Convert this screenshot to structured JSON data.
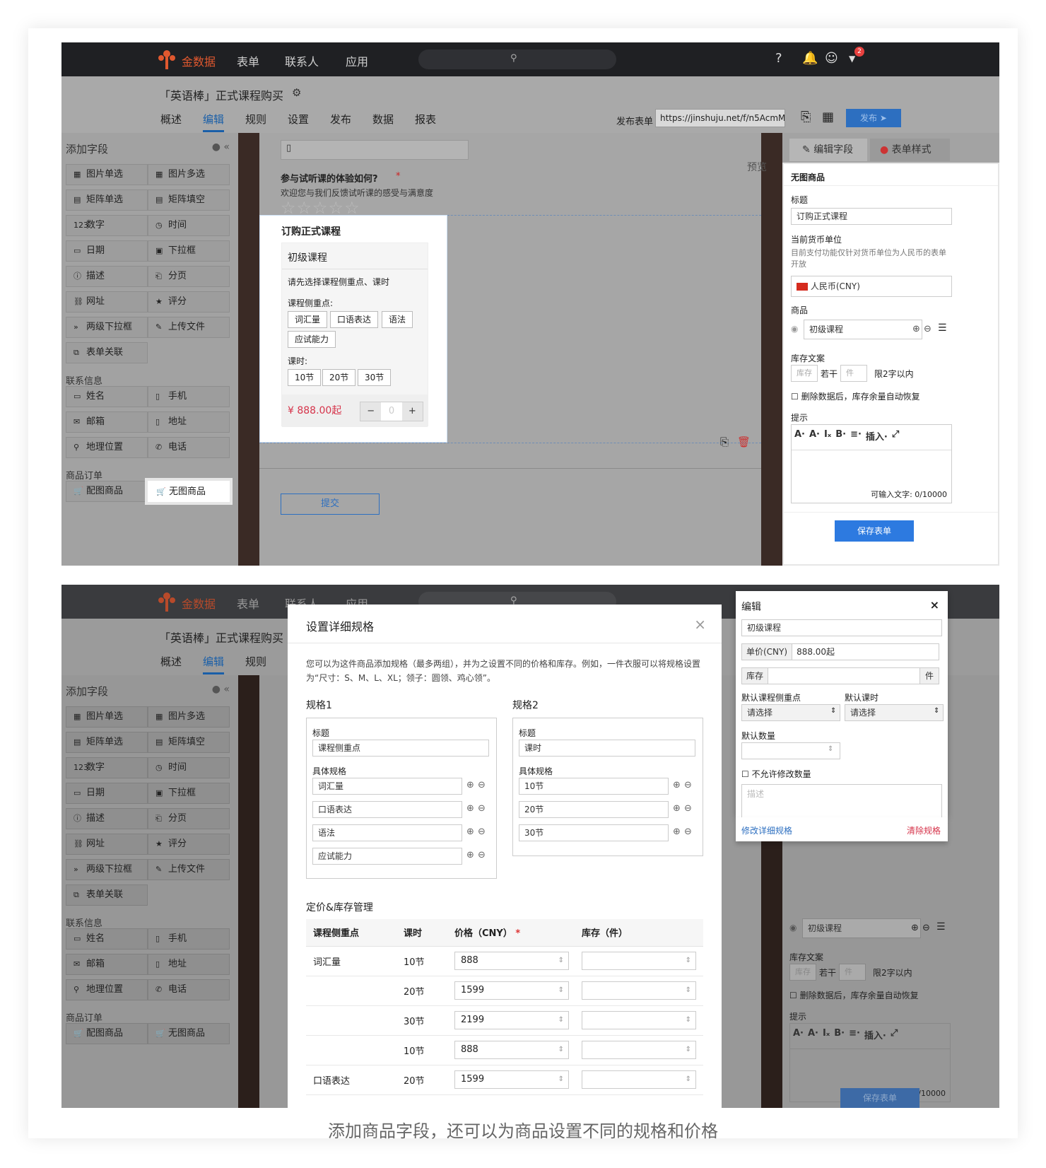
{
  "app": {
    "brand": "金数据",
    "nav": [
      "表单",
      "联系人",
      "应用"
    ],
    "notif_count": "2",
    "form_title": "「英语棒」正式课程购买",
    "tabs": [
      "概述",
      "编辑",
      "规则",
      "设置",
      "发布",
      "数据",
      "报表"
    ],
    "active_tab": "编辑",
    "publish_label": "发布表单",
    "publish_url": "https://jinshuju.net/f/n5AcmM",
    "publish_btn": "发布",
    "add_field_title": "添加字段",
    "collapse": "«",
    "icons": [
      "logo-icon",
      "search-icon",
      "help-icon",
      "bell-icon",
      "avatar-icon",
      "caret-down-icon",
      "copy-icon",
      "qrcode-icon",
      "send-icon",
      "gear-icon"
    ]
  },
  "fields": [
    [
      "图片单选",
      "图片多选"
    ],
    [
      "矩阵单选",
      "矩阵填空"
    ],
    [
      "数字",
      "时间"
    ],
    [
      "日期",
      "下拉框"
    ],
    [
      "描述",
      "分页"
    ],
    [
      "网址",
      "评分"
    ],
    [
      "两级下拉框",
      "上传文件"
    ],
    [
      "表单关联"
    ]
  ],
  "field_icons": [
    [
      "▦",
      "▦"
    ],
    [
      "▤",
      "▤"
    ],
    [
      "123",
      "◷"
    ],
    [
      "▭",
      "▣"
    ],
    [
      "ⓘ",
      "⎗"
    ],
    [
      "⛓",
      "★"
    ],
    [
      "»",
      "✎"
    ],
    [
      "⧉"
    ]
  ],
  "contact_group": "联系信息",
  "contact_fields": [
    [
      "姓名",
      "手机"
    ],
    [
      "邮箱",
      "地址"
    ],
    [
      "地理位置",
      "电话"
    ]
  ],
  "contact_icons": [
    [
      "▭",
      "▯"
    ],
    [
      "✉",
      "▯"
    ],
    [
      "⚲",
      "✆"
    ]
  ],
  "order_group": "商品订单",
  "order_fields": [
    "配图商品",
    "无图商品"
  ],
  "canvas": {
    "q_title": "参与试听课的体验如何?",
    "q_required": "*",
    "q_desc": "欢迎您与我们反馈试听课的感受与满意度",
    "preview": "预览",
    "section_title": "订购正式课程",
    "product_name": "初级课程",
    "choose_hint": "请先选择课程侧重点、课时",
    "focus_label": "课程侧重点:",
    "focus_opts": [
      "词汇量",
      "口语表达",
      "语法",
      "应试能力"
    ],
    "hours_label": "课时:",
    "hours_opts": [
      "10节",
      "20节",
      "30节"
    ],
    "price": "¥ 888.00起",
    "qty_minus": "−",
    "qty_value": "0",
    "qty_plus": "+",
    "submit": "提交"
  },
  "right": {
    "tab1": "编辑字段",
    "tab2": "表单样式",
    "field_type": "无图商品",
    "title_label": "标题",
    "title_value": "订购正式课程",
    "currency_label": "当前货币单位",
    "currency_note": "目前支付功能仅针对货币单位为人民币的表单开放",
    "currency_value": "人民币(CNY)",
    "product_label": "商品",
    "product_value": "初级课程",
    "stock_label": "库存文案",
    "stock_ph1": "库存",
    "stock_mid": "若干",
    "stock_ph2": "件",
    "stock_limit": "限2字以内",
    "auto_restore": "删除数据后，库存余量自动恢复",
    "hint_label": "提示",
    "toolbar": [
      "A·",
      "A·",
      "Iₓ",
      "B·",
      "≡·",
      "插入·",
      "⤢"
    ],
    "char_count": "可输入文字: 0/10000",
    "save": "保存表单"
  },
  "modal": {
    "title": "设置详细规格",
    "close": "×",
    "desc": "您可以为这件商品添加规格（最多两组），并为之设置不同的价格和库存。例如，一件衣服可以将规格设置为“尺寸：S、M、L、XL；领子：圆领、鸡心领”。",
    "spec1": {
      "heading": "规格1",
      "title_label": "标题",
      "title_value": "课程侧重点",
      "items_label": "具体规格",
      "items": [
        "词汇量",
        "口语表达",
        "语法",
        "应试能力"
      ]
    },
    "spec2": {
      "heading": "规格2",
      "title_label": "标题",
      "title_value": "课时",
      "items_label": "具体规格",
      "items": [
        "10节",
        "20节",
        "30节"
      ]
    },
    "pricing_heading": "定价&库存管理",
    "cols": [
      "课程侧重点",
      "课时",
      "价格（CNY）",
      "库存（件）"
    ],
    "required": "*",
    "rows": [
      {
        "focus": "词汇量",
        "hours": "10节",
        "price": "888",
        "stock": ""
      },
      {
        "focus": "",
        "hours": "20节",
        "price": "1599",
        "stock": ""
      },
      {
        "focus": "",
        "hours": "30节",
        "price": "2199",
        "stock": ""
      },
      {
        "focus": "",
        "hours": "10节",
        "price": "888",
        "stock": ""
      },
      {
        "focus": "口语表达",
        "hours": "20节",
        "price": "1599",
        "stock": ""
      }
    ]
  },
  "popover": {
    "title": "编辑",
    "close": "×",
    "name": "初级课程",
    "unit_label": "单价(CNY)",
    "unit_value": "888.00起",
    "stock_label": "库存",
    "stock_unit": "件",
    "default_focus_label": "默认课程侧重点",
    "default_hours_label": "默认课时",
    "select_ph": "请选择",
    "default_qty_label": "默认数量",
    "no_modify": "不允许修改数量",
    "desc_ph": "描述",
    "edit_spec": "修改详细规格",
    "clear_spec": "清除规格"
  },
  "caption": "添加商品字段，还可以为商品设置不同的规格和价格"
}
